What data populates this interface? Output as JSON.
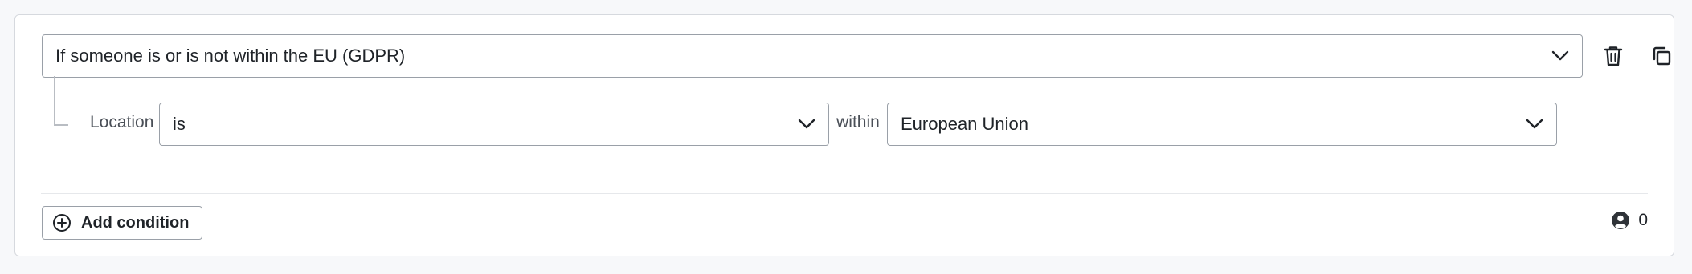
{
  "condition": {
    "rule_select": {
      "value": "If someone is or is not within the EU (GDPR)",
      "icon": "chevron-down-icon"
    },
    "delete_icon": "trash-icon",
    "duplicate_icon": "copy-icon",
    "location": {
      "label": "Location",
      "operator_value": "is",
      "within_label": "within",
      "region_value": "European Union"
    }
  },
  "footer": {
    "add_condition_label": "Add condition",
    "add_icon": "plus-circle-icon",
    "count_icon": "person-circle-icon",
    "count": "0"
  }
}
